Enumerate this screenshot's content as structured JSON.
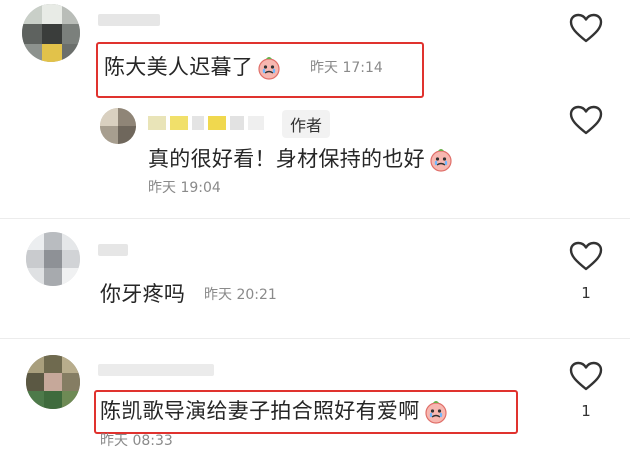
{
  "comments": [
    {
      "text": "陈大美人迟暮了",
      "time": "昨天 17:14",
      "likes": ""
    },
    {
      "text": "真的很好看！身材保持的也好",
      "time": "昨天 19:04",
      "likes": "",
      "tag": "作者"
    },
    {
      "text": "你牙疼吗",
      "time": "昨天 20:21",
      "likes": "1"
    },
    {
      "text": "陈凯歌导演给妻子拍合照好有爱啊",
      "time": "昨天 08:33",
      "likes": "1"
    }
  ],
  "icons": {
    "like": "heart-outline-icon",
    "emoji": "crying-face-icon"
  },
  "colors": {
    "highlight": "#e0322e",
    "meta": "#8a8a8a"
  }
}
